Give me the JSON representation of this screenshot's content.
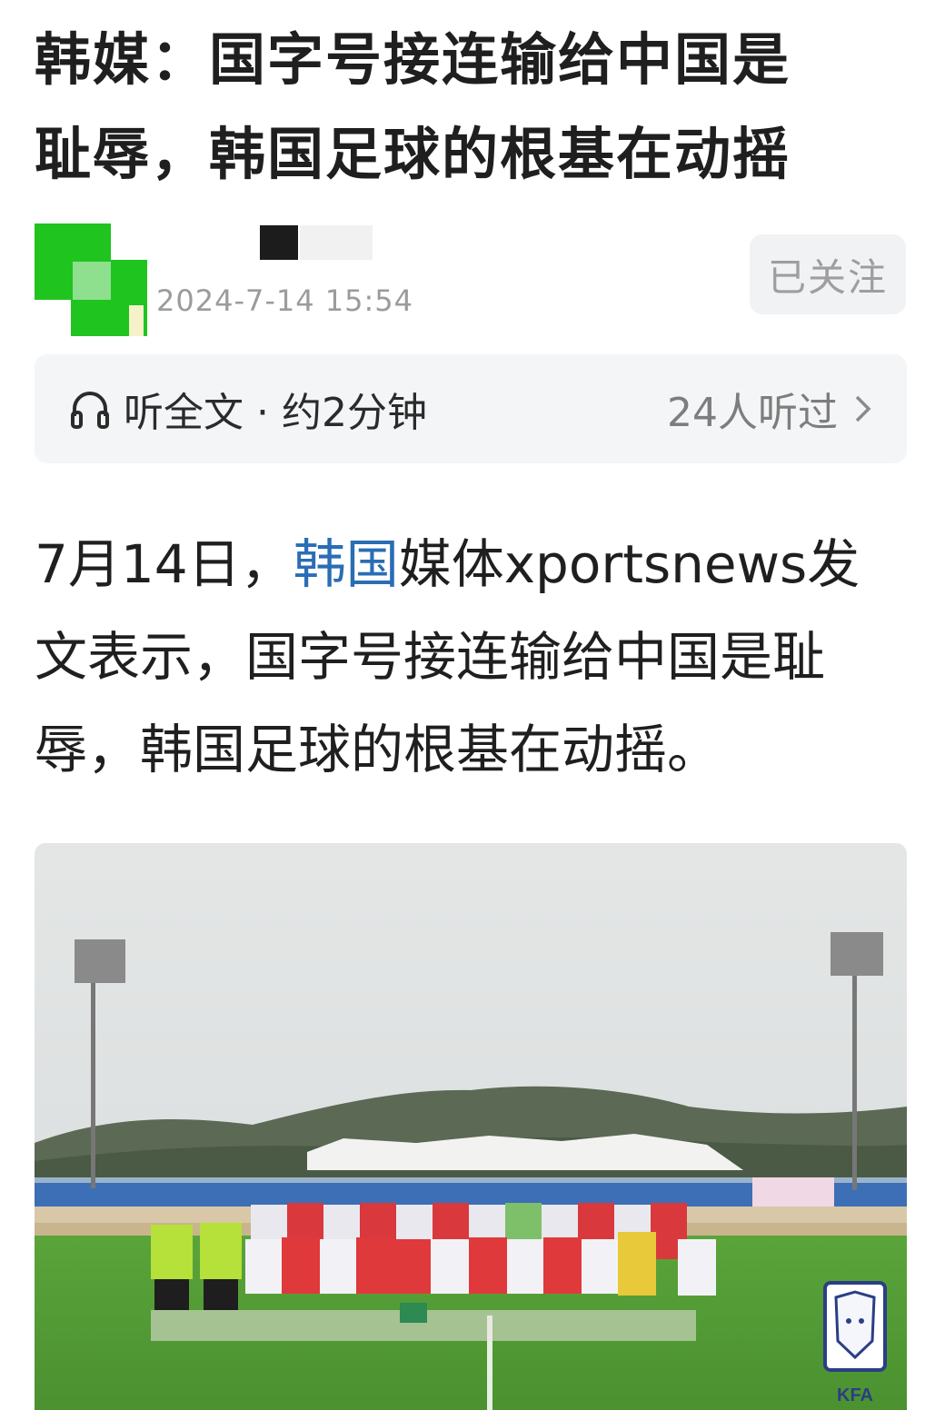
{
  "article": {
    "title_line1": "韩媒：国字号接连输给中国是",
    "title_line2": "耻辱，韩国足球的根基在动摇"
  },
  "author": {
    "time": "2024-7-14  15:54",
    "follow_label": "已关注"
  },
  "listen": {
    "icon": "headphone-icon",
    "label": "听全文 · 约2分钟",
    "listeners": "24人听过"
  },
  "body": {
    "prefix": "7月14日，",
    "link_text": "韩国",
    "rest_line1": "媒体xportsnews发",
    "line2": "文表示，国字号接连输给中国是耻",
    "line3": "辱，韩国足球的根基在动摇。"
  },
  "photo": {
    "logo_text": "KFA"
  },
  "colors": {
    "link": "#2a6db5",
    "muted": "#9b9b9b",
    "avatar_green": "#1fc41f"
  }
}
